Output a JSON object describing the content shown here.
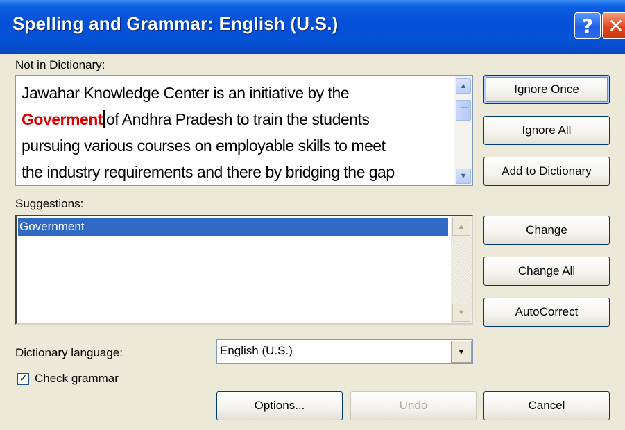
{
  "window": {
    "title": "Spelling and Grammar: English (U.S.)",
    "help_glyph": "?",
    "close_glyph": "✕"
  },
  "not_in_dictionary": {
    "label": "Not in Dictionary:",
    "lines": [
      "Jawahar Knowledge Center is an initiative by the",
      "of Andhra Pradesh to train the students",
      "pursuing various courses on employable skills to meet",
      "the industry requirements and there by bridging the gap"
    ],
    "misspelled_word": "Goverment"
  },
  "suggestions": {
    "label": "Suggestions:",
    "items": [
      "Government"
    ],
    "selected_index": 0
  },
  "buttons": {
    "ignore_once": "Ignore Once",
    "ignore_all": "Ignore All",
    "add_to_dictionary": "Add to Dictionary",
    "change": "Change",
    "change_all": "Change All",
    "autocorrect": "AutoCorrect",
    "options": "Options...",
    "undo": "Undo",
    "cancel": "Cancel"
  },
  "dictionary_language": {
    "label": "Dictionary language:",
    "selected": "English (U.S.)"
  },
  "check_grammar": {
    "label": "Check grammar",
    "checked": true
  },
  "icons": {
    "scroll_up": "▲",
    "scroll_down": "▼",
    "dropdown": "▼",
    "check": "✓"
  },
  "colors": {
    "titlebar": "#0550d8",
    "misspelled": "#e00000",
    "selection": "#316ac5",
    "dialog_bg": "#ece9d8"
  }
}
